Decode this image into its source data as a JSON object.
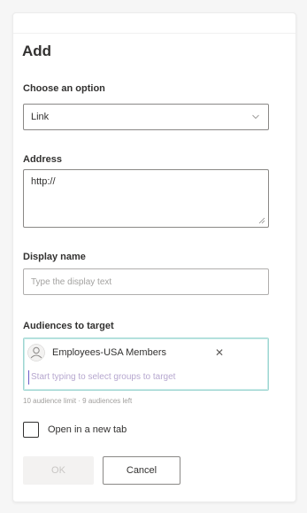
{
  "panel": {
    "title": "Add"
  },
  "choose_option": {
    "label": "Choose an option",
    "value": "Link"
  },
  "address": {
    "label": "Address",
    "value": "http://"
  },
  "display_name": {
    "label": "Display name",
    "placeholder": "Type the display text"
  },
  "audiences": {
    "label": "Audiences to target",
    "chip_label": "Employees-USA Members",
    "remove_symbol": "✕",
    "placeholder": "Start typing to select groups to target",
    "limit_text": "10 audience limit · 9 audiences left"
  },
  "open_new_tab": {
    "label": "Open in a new tab",
    "checked": false
  },
  "buttons": {
    "ok": "OK",
    "cancel": "Cancel"
  },
  "colors": {
    "accent_focus": "#9fd6d2",
    "border": "#8a8886",
    "disabled_bg": "#f3f2f1"
  }
}
